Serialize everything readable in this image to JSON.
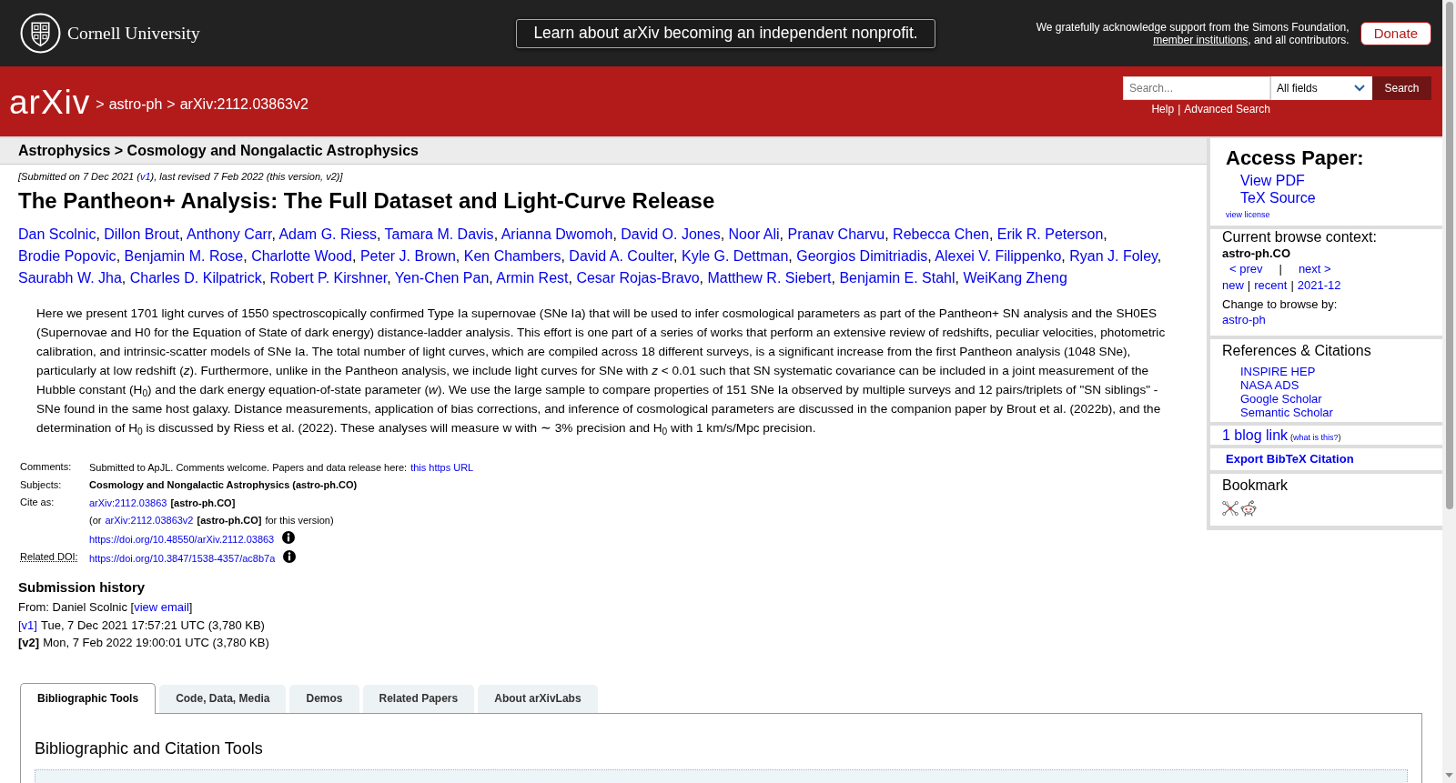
{
  "header": {
    "institution": "Cornell University",
    "announcement": "Learn about arXiv becoming an independent nonprofit.",
    "support": {
      "before": "We gratefully acknowledge support from the Simons Foundation,",
      "link": "member institutions",
      "after": ", and all contributors."
    },
    "donate_button": "Donate"
  },
  "navbar": {
    "logo": "arXiv",
    "breadcrumbs": [
      {
        "separator": ">",
        "label": "astro-ph"
      },
      {
        "separator": ">",
        "label": "arXiv:2112.03863v2"
      }
    ],
    "search": {
      "placeholder": "Search...",
      "field": "All fields",
      "button": "Search"
    },
    "help_links": [
      {
        "label": "Help"
      },
      {
        "separator": "|",
        "label": "Advanced Search"
      }
    ]
  },
  "subject_bar": "Astrophysics > Cosmology and Nongalactic Astrophysics",
  "dateline": {
    "before": "[Submitted on 7 Dec 2021 (",
    "link": "v1",
    "after": "), last revised 7 Feb 2022 (this version, v2)]"
  },
  "title": "The Pantheon+ Analysis: The Full Dataset and Light-Curve Release",
  "authors": [
    {
      "name": "Dan Scolnic",
      "after": ","
    },
    {
      "name": "Dillon Brout",
      "after": ","
    },
    {
      "name": "Anthony Carr",
      "after": ","
    },
    {
      "name": "Adam G. Riess",
      "after": ","
    },
    {
      "name": "Tamara M. Davis",
      "after": ","
    },
    {
      "name": "Arianna Dwomoh",
      "after": ","
    },
    {
      "name": "David O. Jones",
      "after": ","
    },
    {
      "name": "Noor Ali",
      "after": ","
    },
    {
      "name": "Pranav Charvu",
      "after": ","
    },
    {
      "name": "Rebecca Chen",
      "after": ","
    },
    {
      "name": "Erik R. Peterson",
      "after": ","
    },
    {
      "name": "Brodie Popovic",
      "after": ","
    },
    {
      "name": "Benjamin M. Rose",
      "after": ","
    },
    {
      "name": "Charlotte Wood",
      "after": ","
    },
    {
      "name": "Peter J. Brown",
      "after": ","
    },
    {
      "name": "Ken Chambers",
      "after": ","
    },
    {
      "name": "David A. Coulter",
      "after": ","
    },
    {
      "name": "Kyle G. Dettman",
      "after": ","
    },
    {
      "name": "Georgios Dimitriadis",
      "after": ","
    },
    {
      "name": "Alexei V. Filippenko",
      "after": ","
    },
    {
      "name": "Ryan J. Foley",
      "after": ","
    },
    {
      "name": "Saurabh W. Jha",
      "after": ","
    },
    {
      "name": "Charles D. Kilpatrick",
      "after": ","
    },
    {
      "name": "Robert P. Kirshner",
      "after": ","
    },
    {
      "name": "Yen-Chen Pan",
      "after": ","
    },
    {
      "name": "Armin Rest",
      "after": ","
    },
    {
      "name": "Cesar Rojas-Bravo",
      "after": ","
    },
    {
      "name": "Matthew R. Siebert",
      "after": ","
    },
    {
      "name": "Benjamin E. Stahl",
      "after": ","
    },
    {
      "name": "WeiKang Zheng"
    }
  ],
  "abstract": "Here we present 1701 light curves of 1550 spectroscopically confirmed Type Ia supernovae (SNe Ia) that will be used to infer cosmological parameters as part of the Pantheon+ SN analysis and the SH0ES (Supernovae and H0 for the Equation of State of dark energy) distance-ladder analysis. This effort is one part of a series of works that perform an extensive review of redshifts, peculiar velocities, photometric calibration, and intrinsic-scatter models of SNe Ia. The total number of light curves, which are compiled across 18 different surveys, is a significant increase from the first Pantheon analysis (1048 SNe), particularly at low redshift (*z*). Furthermore, unlike in the Pantheon analysis, we include light curves for SNe with *z* < 0.01 such that SN systematic covariance can be included in a joint measurement of the Hubble constant (H$_{0}$) and the dark energy equation-of-state parameter (*w*). We use the large sample to compare properties of 151 SNe Ia observed by multiple surveys and 12 pairs/triplets of \"SN siblings\" - SNe found in the same host galaxy. Distance measurements, application of bias corrections, and inference of cosmological parameters are discussed in the companion paper by Brout et al. (2022b), and the determination of H$_{0}$ is discussed by Riess et al. (2022). These analyses will measure w with ∼ 3% precision and H$_{0}$ with 1 km/s/Mpc precision.",
  "metadata": [
    {
      "label": "Comments:",
      "abbreviation": false,
      "lines": [
        [
          {
            "kind": "text",
            "text": "Submitted to ApJL. Comments welcome. Papers and data release here:"
          },
          {
            "kind": "link",
            "text": "this https URL"
          }
        ]
      ]
    },
    {
      "label": "Subjects:",
      "abbreviation": false,
      "lines": [
        [
          {
            "kind": "bold",
            "text": "Cosmology and Nongalactic Astrophysics (astro-ph.CO)"
          }
        ]
      ]
    },
    {
      "label": "Cite as:",
      "abbreviation": false,
      "lines": [
        [
          {
            "kind": "link",
            "text": "arXiv:2112.03863"
          },
          {
            "kind": "bold",
            "text": "[astro-ph.CO]"
          }
        ],
        [
          {
            "kind": "text",
            "text": "(or"
          },
          {
            "kind": "link",
            "text": "arXiv:2112.03863v2"
          },
          {
            "kind": "bold",
            "text": "[astro-ph.CO]"
          },
          {
            "kind": "text",
            "text": "for this version)"
          }
        ],
        [
          {
            "kind": "link",
            "text": "https://doi.org/10.48550/arXiv.2112.03863"
          },
          {
            "kind": "info"
          }
        ]
      ]
    },
    {
      "label": "Related DOI:",
      "abbreviation": true,
      "lines": [
        [
          {
            "kind": "link",
            "text": "https://doi.org/10.3847/1538-4357/ac8b7a"
          },
          {
            "kind": "info"
          }
        ]
      ]
    }
  ],
  "submission_history": {
    "heading": "Submission history",
    "from": {
      "before": "From: Daniel Scolnic [",
      "link": "view email",
      "after": "]"
    },
    "versions": [
      {
        "version": "[v1]",
        "current": false,
        "details": "Tue, 7 Dec 2021 17:57:21 UTC (3,780 KB)"
      },
      {
        "version": "[v2]",
        "current": true,
        "details": "Mon, 7 Feb 2022 19:00:01 UTC (3,780 KB)"
      }
    ]
  },
  "sidebar": {
    "access_paper": {
      "heading": "Access Paper:",
      "links": [
        "View PDF",
        "TeX Source"
      ],
      "license": "view license"
    },
    "browse_context": {
      "heading": "Current browse context:",
      "category": "astro-ph.CO",
      "prev": "< prev",
      "divider": "|",
      "next": "next >",
      "periods": [
        {
          "label": "new"
        },
        {
          "separator": "|",
          "label": "recent"
        },
        {
          "separator": "|",
          "label": "2021-12"
        }
      ],
      "change_label": "Change to browse by:",
      "change_links": [
        "astro-ph"
      ]
    },
    "references": {
      "heading": "References & Citations",
      "links": [
        "INSPIRE HEP",
        "NASA ADS",
        "Google Scholar",
        "Semantic Scholar"
      ]
    },
    "blog": {
      "link": "1 blog link",
      "note": {
        "before": "(",
        "link": "what is this?",
        "after": ")"
      }
    },
    "export_citation": "Export BibTeX Citation",
    "bookmark": {
      "heading": "Bookmark"
    }
  },
  "tabs": [
    {
      "label": "Bibliographic Tools",
      "selected": true
    },
    {
      "label": "Code, Data, Media",
      "selected": false
    },
    {
      "label": "Demos",
      "selected": false
    },
    {
      "label": "Related Papers",
      "selected": false
    },
    {
      "label": "About arXivLabs",
      "selected": false
    }
  ],
  "tab_panel": {
    "heading": "Bibliographic and Citation Tools"
  }
}
